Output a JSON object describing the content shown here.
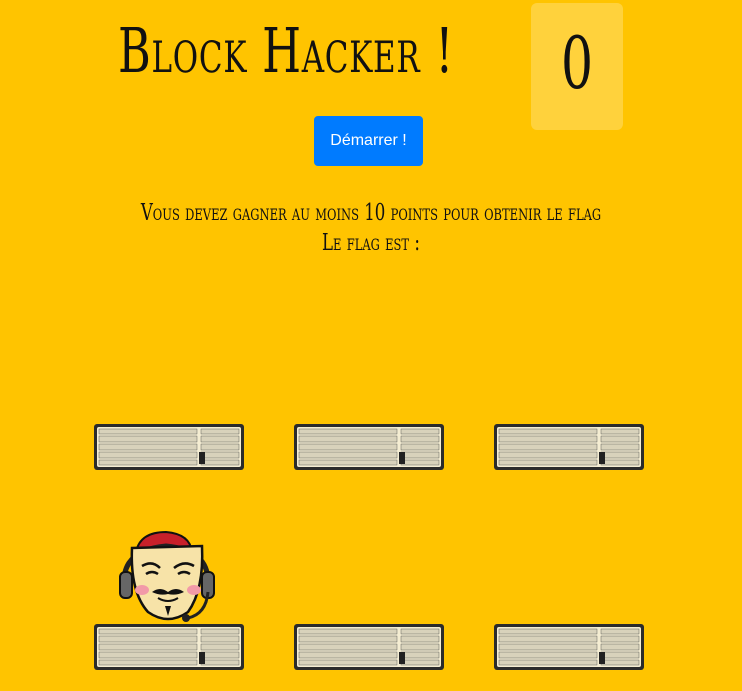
{
  "game": {
    "title": "Block Hacker !",
    "score": "0",
    "start_label": "Démarrer !",
    "instruction": "Vous devez gagner au moins 10 points pour obtenir le flag",
    "flag_label": "Le flag est :",
    "flag_value": ""
  },
  "board": {
    "rows": 2,
    "cols": 3,
    "hacker_hole": 3
  },
  "icons": {
    "hole": "keyboard-icon",
    "target": "anonymous-hacker-mask-icon"
  },
  "colors": {
    "background": "#ffc400",
    "score_box": "#ffd23c",
    "button": "#007bff",
    "button_text": "#ffffff"
  }
}
